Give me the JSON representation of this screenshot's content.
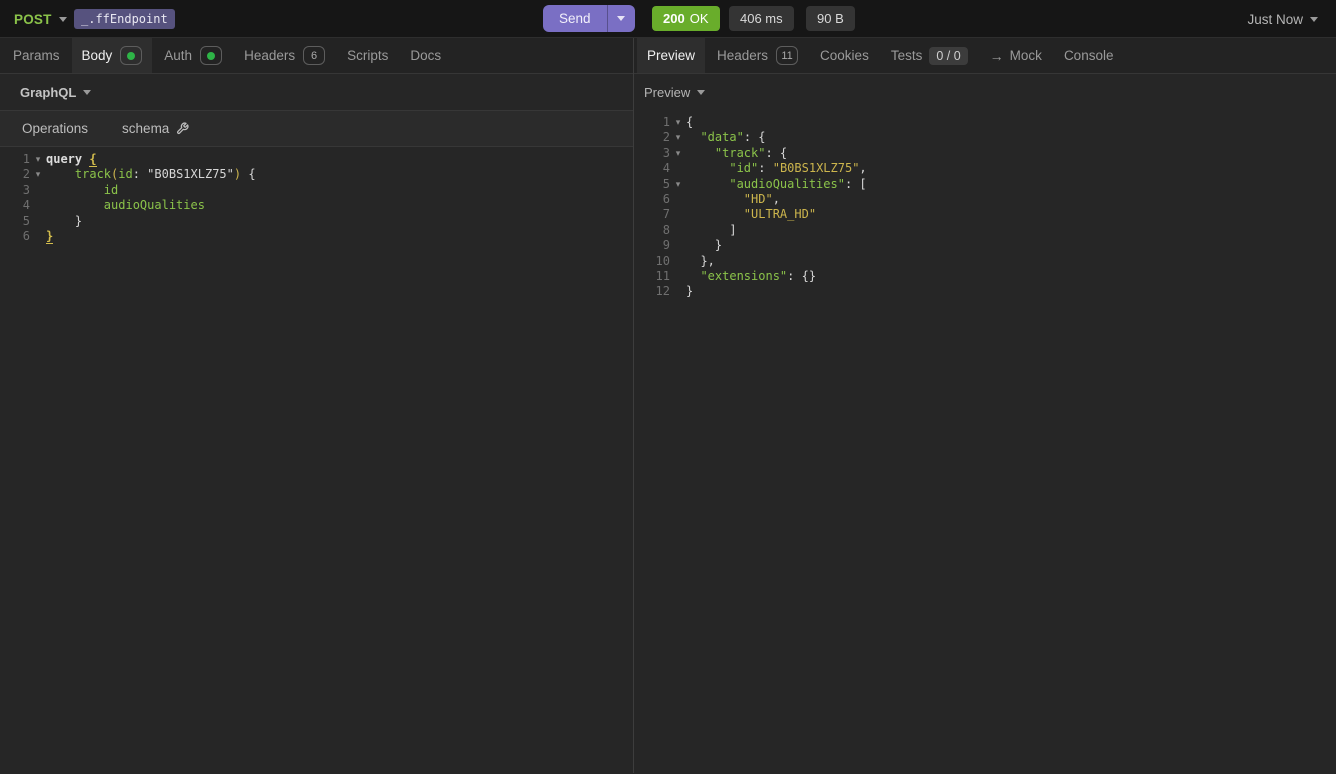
{
  "topbar": {
    "method": "POST",
    "url": "_.ffEndpoint",
    "send_label": "Send",
    "status_code": "200",
    "status_text": "OK",
    "duration": "406 ms",
    "size": "90 B",
    "history_label": "Just Now",
    "accent_green": "#8bc34a",
    "status_green": "#69ad2b",
    "send_purple": "#7a6fc4",
    "url_pill_purple": "#56527e"
  },
  "request_tabs": {
    "params": "Params",
    "body": "Body",
    "auth": "Auth",
    "headers": "Headers",
    "headers_count": "6",
    "scripts": "Scripts",
    "docs": "Docs"
  },
  "body_type": {
    "label": "GraphQL"
  },
  "graphql_bar": {
    "operations": "Operations",
    "schema": "schema"
  },
  "response_tabs": {
    "preview": "Preview",
    "headers": "Headers",
    "headers_count": "11",
    "cookies": "Cookies",
    "tests": "Tests",
    "tests_count": "0 / 0",
    "mock": "Mock",
    "console": "Console"
  },
  "response_view": {
    "label": "Preview"
  },
  "request_editor": {
    "lines": [
      {
        "n": 1,
        "fold": true,
        "tokens": [
          [
            "kw",
            "query "
          ],
          [
            "match",
            "{"
          ]
        ]
      },
      {
        "n": 2,
        "fold": true,
        "tokens": [
          [
            "pln",
            "    "
          ],
          [
            "name",
            "track"
          ],
          [
            "par",
            "("
          ],
          [
            "name",
            "id"
          ],
          [
            "pln",
            ": \"B0BS1XLZ75\""
          ],
          [
            "par",
            ")"
          ],
          [
            "pln",
            " {"
          ]
        ]
      },
      {
        "n": 3,
        "fold": false,
        "tokens": [
          [
            "pln",
            "        "
          ],
          [
            "name",
            "id"
          ]
        ]
      },
      {
        "n": 4,
        "fold": false,
        "tokens": [
          [
            "pln",
            "        "
          ],
          [
            "name",
            "audioQualities"
          ]
        ]
      },
      {
        "n": 5,
        "fold": false,
        "tokens": [
          [
            "pln",
            "    }"
          ]
        ]
      },
      {
        "n": 6,
        "fold": false,
        "tokens": [
          [
            "match",
            "}"
          ]
        ]
      }
    ]
  },
  "response_editor": {
    "lines": [
      {
        "n": 1,
        "fold": true,
        "tokens": [
          [
            "pln",
            "{"
          ]
        ]
      },
      {
        "n": 2,
        "fold": true,
        "tokens": [
          [
            "pln",
            "  "
          ],
          [
            "key",
            "\"data\""
          ],
          [
            "pln",
            ": {"
          ]
        ]
      },
      {
        "n": 3,
        "fold": true,
        "tokens": [
          [
            "pln",
            "    "
          ],
          [
            "key",
            "\"track\""
          ],
          [
            "pln",
            ": {"
          ]
        ]
      },
      {
        "n": 4,
        "fold": false,
        "tokens": [
          [
            "pln",
            "      "
          ],
          [
            "key",
            "\"id\""
          ],
          [
            "pln",
            ": "
          ],
          [
            "str",
            "\"B0BS1XLZ75\""
          ],
          [
            "pln",
            ","
          ]
        ]
      },
      {
        "n": 5,
        "fold": true,
        "tokens": [
          [
            "pln",
            "      "
          ],
          [
            "key",
            "\"audioQualities\""
          ],
          [
            "pln",
            ": ["
          ]
        ]
      },
      {
        "n": 6,
        "fold": false,
        "tokens": [
          [
            "pln",
            "        "
          ],
          [
            "str",
            "\"HD\""
          ],
          [
            "pln",
            ","
          ]
        ]
      },
      {
        "n": 7,
        "fold": false,
        "tokens": [
          [
            "pln",
            "        "
          ],
          [
            "str",
            "\"ULTRA_HD\""
          ]
        ]
      },
      {
        "n": 8,
        "fold": false,
        "tokens": [
          [
            "pln",
            "      ]"
          ]
        ]
      },
      {
        "n": 9,
        "fold": false,
        "tokens": [
          [
            "pln",
            "    }"
          ]
        ]
      },
      {
        "n": 10,
        "fold": false,
        "tokens": [
          [
            "pln",
            "  },"
          ]
        ]
      },
      {
        "n": 11,
        "fold": false,
        "tokens": [
          [
            "pln",
            "  "
          ],
          [
            "key",
            "\"extensions\""
          ],
          [
            "pln",
            ": {}"
          ]
        ]
      },
      {
        "n": 12,
        "fold": false,
        "tokens": [
          [
            "pln",
            "}"
          ]
        ]
      }
    ]
  }
}
